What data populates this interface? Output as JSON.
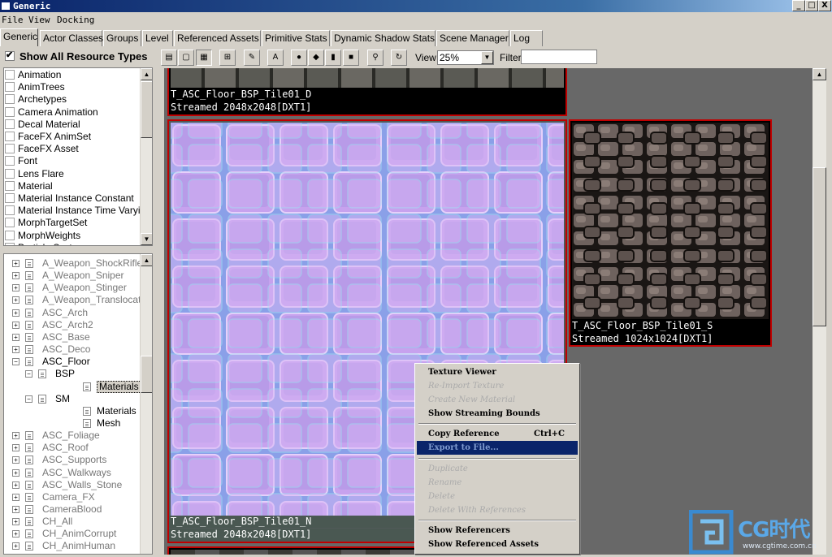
{
  "window": {
    "title": "Generic",
    "min": "_",
    "max": "□",
    "close": "X"
  },
  "menu": [
    "File",
    "View",
    "Docking"
  ],
  "tabs": [
    "Generic",
    "Actor Classes",
    "Groups",
    "Level",
    "Referenced Assets",
    "Primitive Stats",
    "Dynamic Shadow Stats",
    "Scene Manager",
    "Log"
  ],
  "left": {
    "show_all_label": "Show All Resource Types",
    "resource_types": [
      "Animation",
      "AnimTrees",
      "Archetypes",
      "Camera Animation",
      "Decal Material",
      "FaceFX AnimSet",
      "FaceFX Asset",
      "Font",
      "Lens Flare",
      "Material",
      "Material Instance Constant",
      "Material Instance Time Varying",
      "MorphTargetSet",
      "MorphWeights",
      "Particle System"
    ],
    "tree": [
      "A_Weapon_ShockRifle",
      "A_Weapon_Sniper",
      "A_Weapon_Stinger",
      "A_Weapon_Translocator",
      "ASC_Arch",
      "ASC_Arch2",
      "ASC_Base",
      "ASC_Deco",
      "ASC_Floor",
      "BSP",
      "Materials",
      "SM",
      "Materials",
      "Mesh",
      "ASC_Foliage",
      "ASC_Roof",
      "ASC_Supports",
      "ASC_Walkways",
      "ASC_Walls_Stone",
      "Camera_FX",
      "CameraBlood",
      "CH_All",
      "CH_AnimCorrupt",
      "CH_AnimHuman"
    ]
  },
  "toolbar": {
    "view_label": "View",
    "view_value": "25%",
    "filter_label": "Filter",
    "filter_value": ""
  },
  "assets": [
    {
      "name": "T_ASC_Floor_BSP_Tile01_D",
      "info": "Streamed 2048x2048[DXT1]"
    },
    {
      "name": "T_ASC_Floor_BSP_Tile01_N",
      "info": "Streamed 2048x2048[DXT1]"
    },
    {
      "name": "T_ASC_Floor_BSP_Tile01_S",
      "info": "Streamed 1024x1024[DXT1]"
    }
  ],
  "context_menu": {
    "texture_viewer": "Texture Viewer",
    "reimport": "Re-Import Texture",
    "create_material": "Create New Material",
    "show_streaming": "Show Streaming Bounds",
    "copy_reference": "Copy Reference",
    "copy_shortcut": "Ctrl+C",
    "export": "Export to File...",
    "duplicate": "Duplicate",
    "rename": "Rename",
    "delete": "Delete",
    "delete_refs": "Delete With References",
    "show_referencers": "Show Referencers",
    "show_referenced": "Show Referenced Assets"
  },
  "watermark": {
    "brand": "CG时代",
    "url": "www.cgtime.com.cn"
  },
  "colors": {
    "selection": "#0a246a",
    "tile_border": "#c00000",
    "background": "#686868"
  }
}
